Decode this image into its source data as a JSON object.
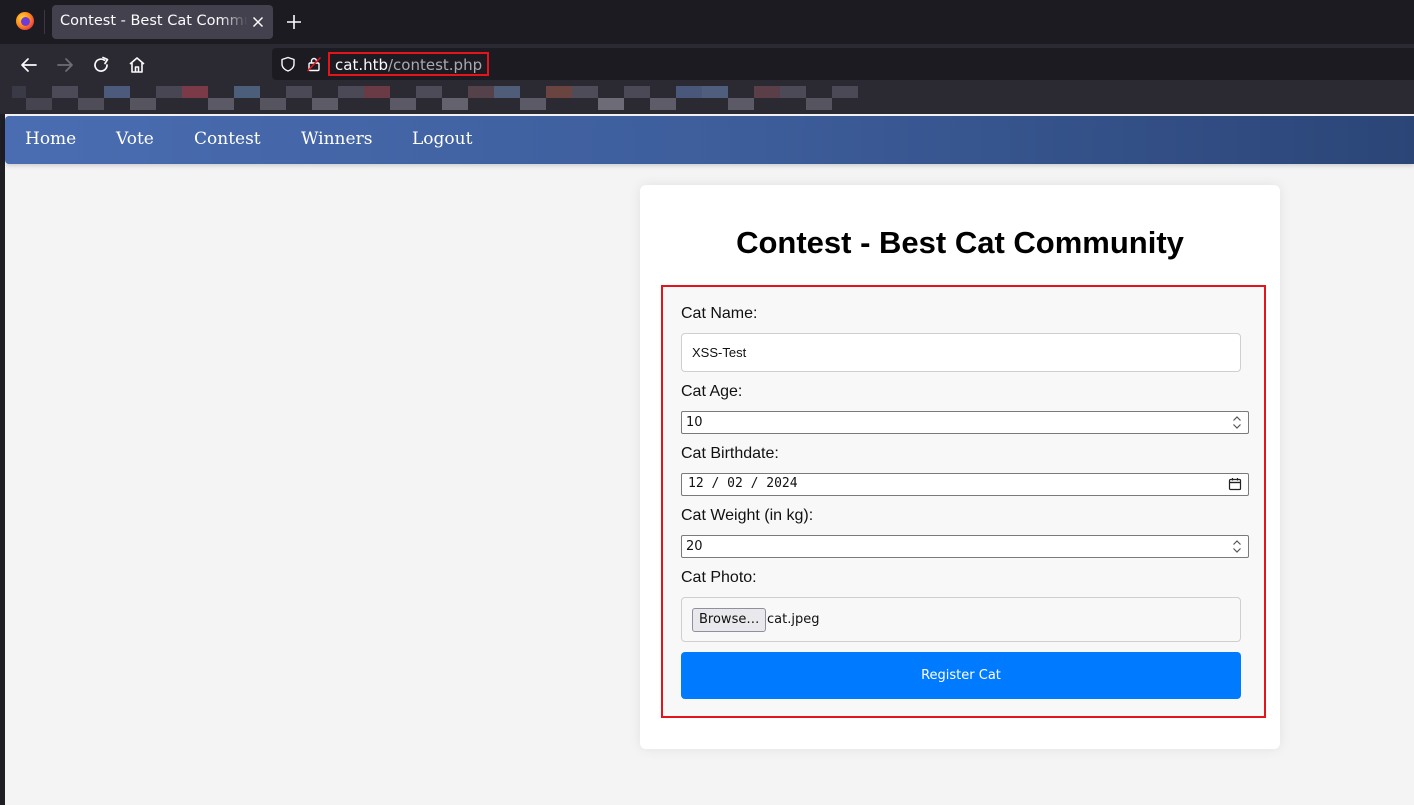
{
  "browser": {
    "tab_title": "Contest - Best Cat Community",
    "url_host": "cat.htb",
    "url_path": "/contest.php"
  },
  "site_nav": {
    "items": [
      {
        "label": "Home"
      },
      {
        "label": "Vote"
      },
      {
        "label": "Contest"
      },
      {
        "label": "Winners"
      },
      {
        "label": "Logout"
      }
    ]
  },
  "page": {
    "title": "Contest - Best Cat Community"
  },
  "form": {
    "cat_name_label": "Cat Name:",
    "cat_name_value": "XSS-Test",
    "cat_age_label": "Cat Age:",
    "cat_age_value": "10",
    "cat_birthdate_label": "Cat Birthdate:",
    "cat_birthdate_value": "12 / 02 / 2024",
    "cat_weight_label": "Cat Weight (in kg):",
    "cat_weight_value": "20",
    "cat_photo_label": "Cat Photo:",
    "browse_label": "Browse…",
    "file_name": "cat.jpeg",
    "submit_label": "Register Cat"
  },
  "colors": {
    "highlight_border": "#e4141c",
    "submit_button": "#007bff",
    "nav_gradient_start": "#4a6db2",
    "nav_gradient_end": "#2b4577"
  }
}
